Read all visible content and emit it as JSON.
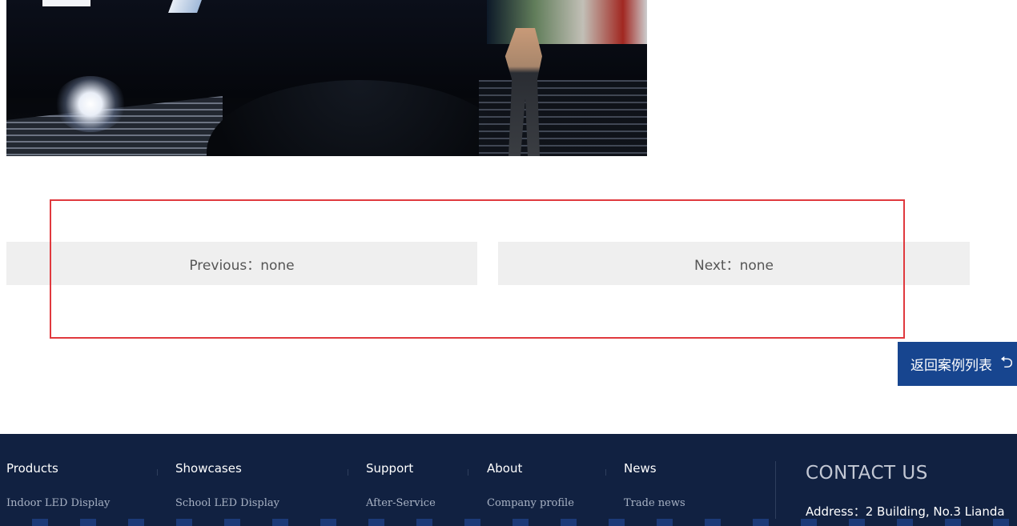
{
  "pager": {
    "previous_label": "Previous：none",
    "next_label": "Next：none"
  },
  "back_button": {
    "label": "返回案例列表",
    "icon": "return-arrow-icon"
  },
  "footer": {
    "columns": [
      {
        "title": "Products",
        "first_item": "Indoor LED Display"
      },
      {
        "title": "Showcases",
        "first_item": "School LED Display"
      },
      {
        "title": "Support",
        "first_item": "After-Service"
      },
      {
        "title": "About",
        "first_item": "Company profile"
      },
      {
        "title": "News",
        "first_item": "Trade  news"
      }
    ],
    "contact_title": "CONTACT US",
    "contact_address": "Address：2 Building, No.3 Lianda"
  },
  "colors": {
    "highlight": "#e0393e",
    "accent": "#17458f",
    "footer_bg": "#112141"
  }
}
